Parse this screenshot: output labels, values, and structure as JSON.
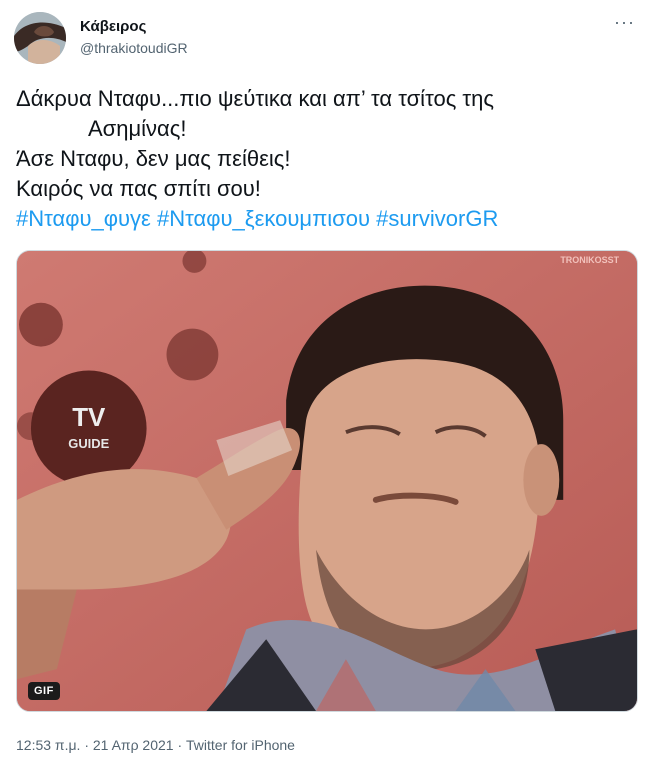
{
  "user": {
    "display_name": "Κάβειρος",
    "handle": "@thrakiotoudiGR"
  },
  "more_glyph": "···",
  "tweet": {
    "line1": "Δάκρυα Νταφυ...πιο ψεύτικα και απ’ τα τσίτος της",
    "line2": "Ασημίνας!",
    "line3": "Άσε Νταφυ, δεν μας πείθεις!",
    "line4": "Καιρός να πας σπίτι σου!",
    "hashtags": [
      "#Νταφυ_φυγε",
      "#Νταφυ_ξεκουμπισου",
      "#survivorGR"
    ]
  },
  "media": {
    "watermark": "TRONIKOSST",
    "mic_text_1": "TV",
    "mic_text_2": "GUIDE",
    "badge": "GIF"
  },
  "meta": {
    "time": "12:53 π.μ.",
    "separator": " · ",
    "date": "21 Απρ 2021",
    "source": "Twitter for iPhone"
  },
  "colors": {
    "link": "#1d9bf0",
    "secondary": "#536471",
    "background_red": "#c86d66"
  }
}
